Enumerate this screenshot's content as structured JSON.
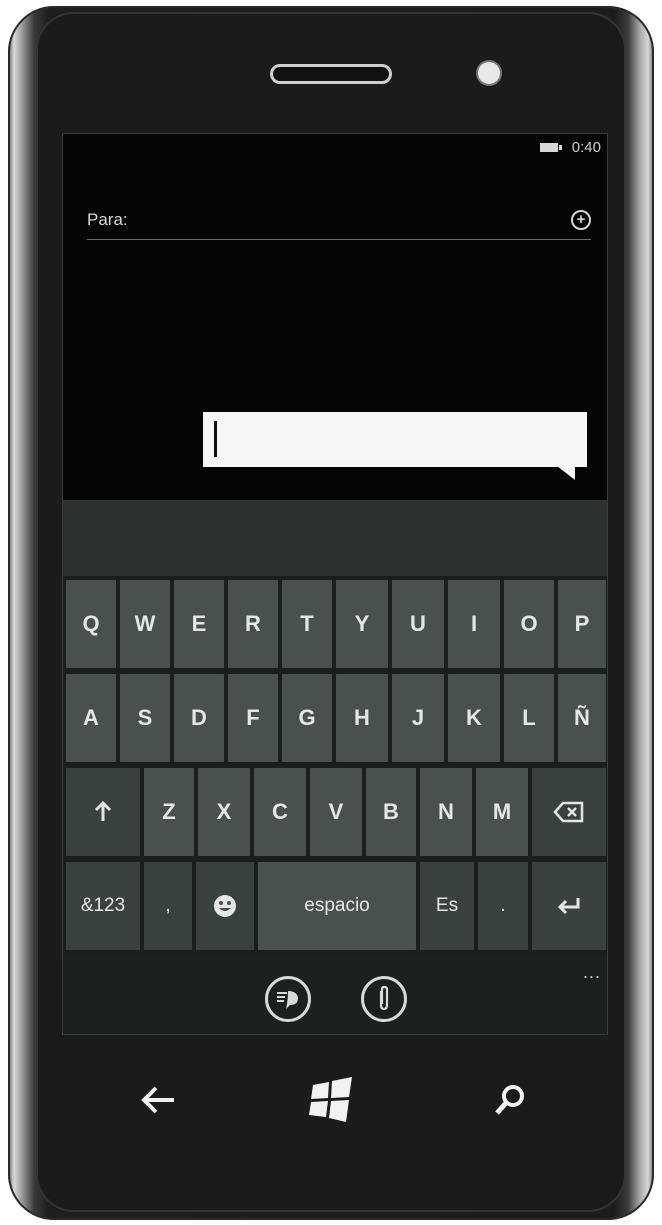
{
  "status": {
    "time": "0:40",
    "battery_icon": "battery-icon"
  },
  "compose": {
    "to_label": "Para:",
    "add_contact_icon": "plus-circle-icon",
    "message_placeholder": ""
  },
  "keyboard": {
    "row1": [
      "Q",
      "W",
      "E",
      "R",
      "T",
      "Y",
      "U",
      "I",
      "O",
      "P"
    ],
    "row2": [
      "A",
      "S",
      "D",
      "F",
      "G",
      "H",
      "J",
      "K",
      "L",
      "Ñ"
    ],
    "row3": [
      "Z",
      "X",
      "C",
      "V",
      "B",
      "N",
      "M"
    ],
    "shift_icon": "up-arrow-icon",
    "backspace_icon": "backspace-icon",
    "symbols_label": "&123",
    "comma_label": ",",
    "emoji_icon": "emoji-icon",
    "space_label": "espacio",
    "language_label": "Es",
    "period_label": ".",
    "enter_icon": "enter-icon"
  },
  "app_bar": {
    "more_label": "...",
    "voice_note_icon": "speech-icon",
    "attach_icon": "paperclip-icon"
  },
  "nav": {
    "back_icon": "back-arrow-icon",
    "start_icon": "windows-logo-icon",
    "search_icon": "search-icon"
  }
}
